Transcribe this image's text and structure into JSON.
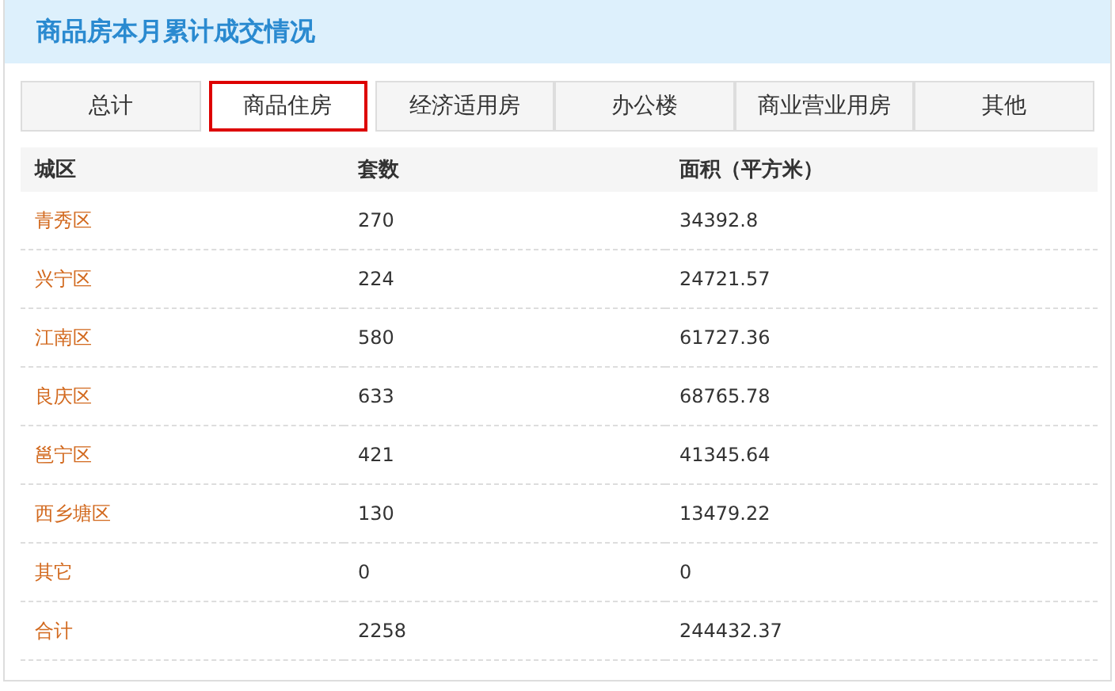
{
  "panel": {
    "title": "商品房本月累计成交情况"
  },
  "tabs": [
    {
      "label": "总计",
      "selected": false
    },
    {
      "label": "商品住房",
      "selected": true
    },
    {
      "label": "经济适用房",
      "selected": false
    },
    {
      "label": "办公楼",
      "selected": false
    },
    {
      "label": "商业营业用房",
      "selected": false
    },
    {
      "label": "其他",
      "selected": false
    }
  ],
  "table": {
    "columns": [
      "城区",
      "套数",
      "面积（平方米）"
    ],
    "rows": [
      [
        "青秀区",
        "270",
        "34392.8"
      ],
      [
        "兴宁区",
        "224",
        "24721.57"
      ],
      [
        "江南区",
        "580",
        "61727.36"
      ],
      [
        "良庆区",
        "633",
        "68765.78"
      ],
      [
        "邕宁区",
        "421",
        "41345.64"
      ],
      [
        "西乡塘区",
        "130",
        "13479.22"
      ],
      [
        "其它",
        "0",
        "0"
      ],
      [
        "合计",
        "2258",
        "244432.37"
      ]
    ]
  }
}
